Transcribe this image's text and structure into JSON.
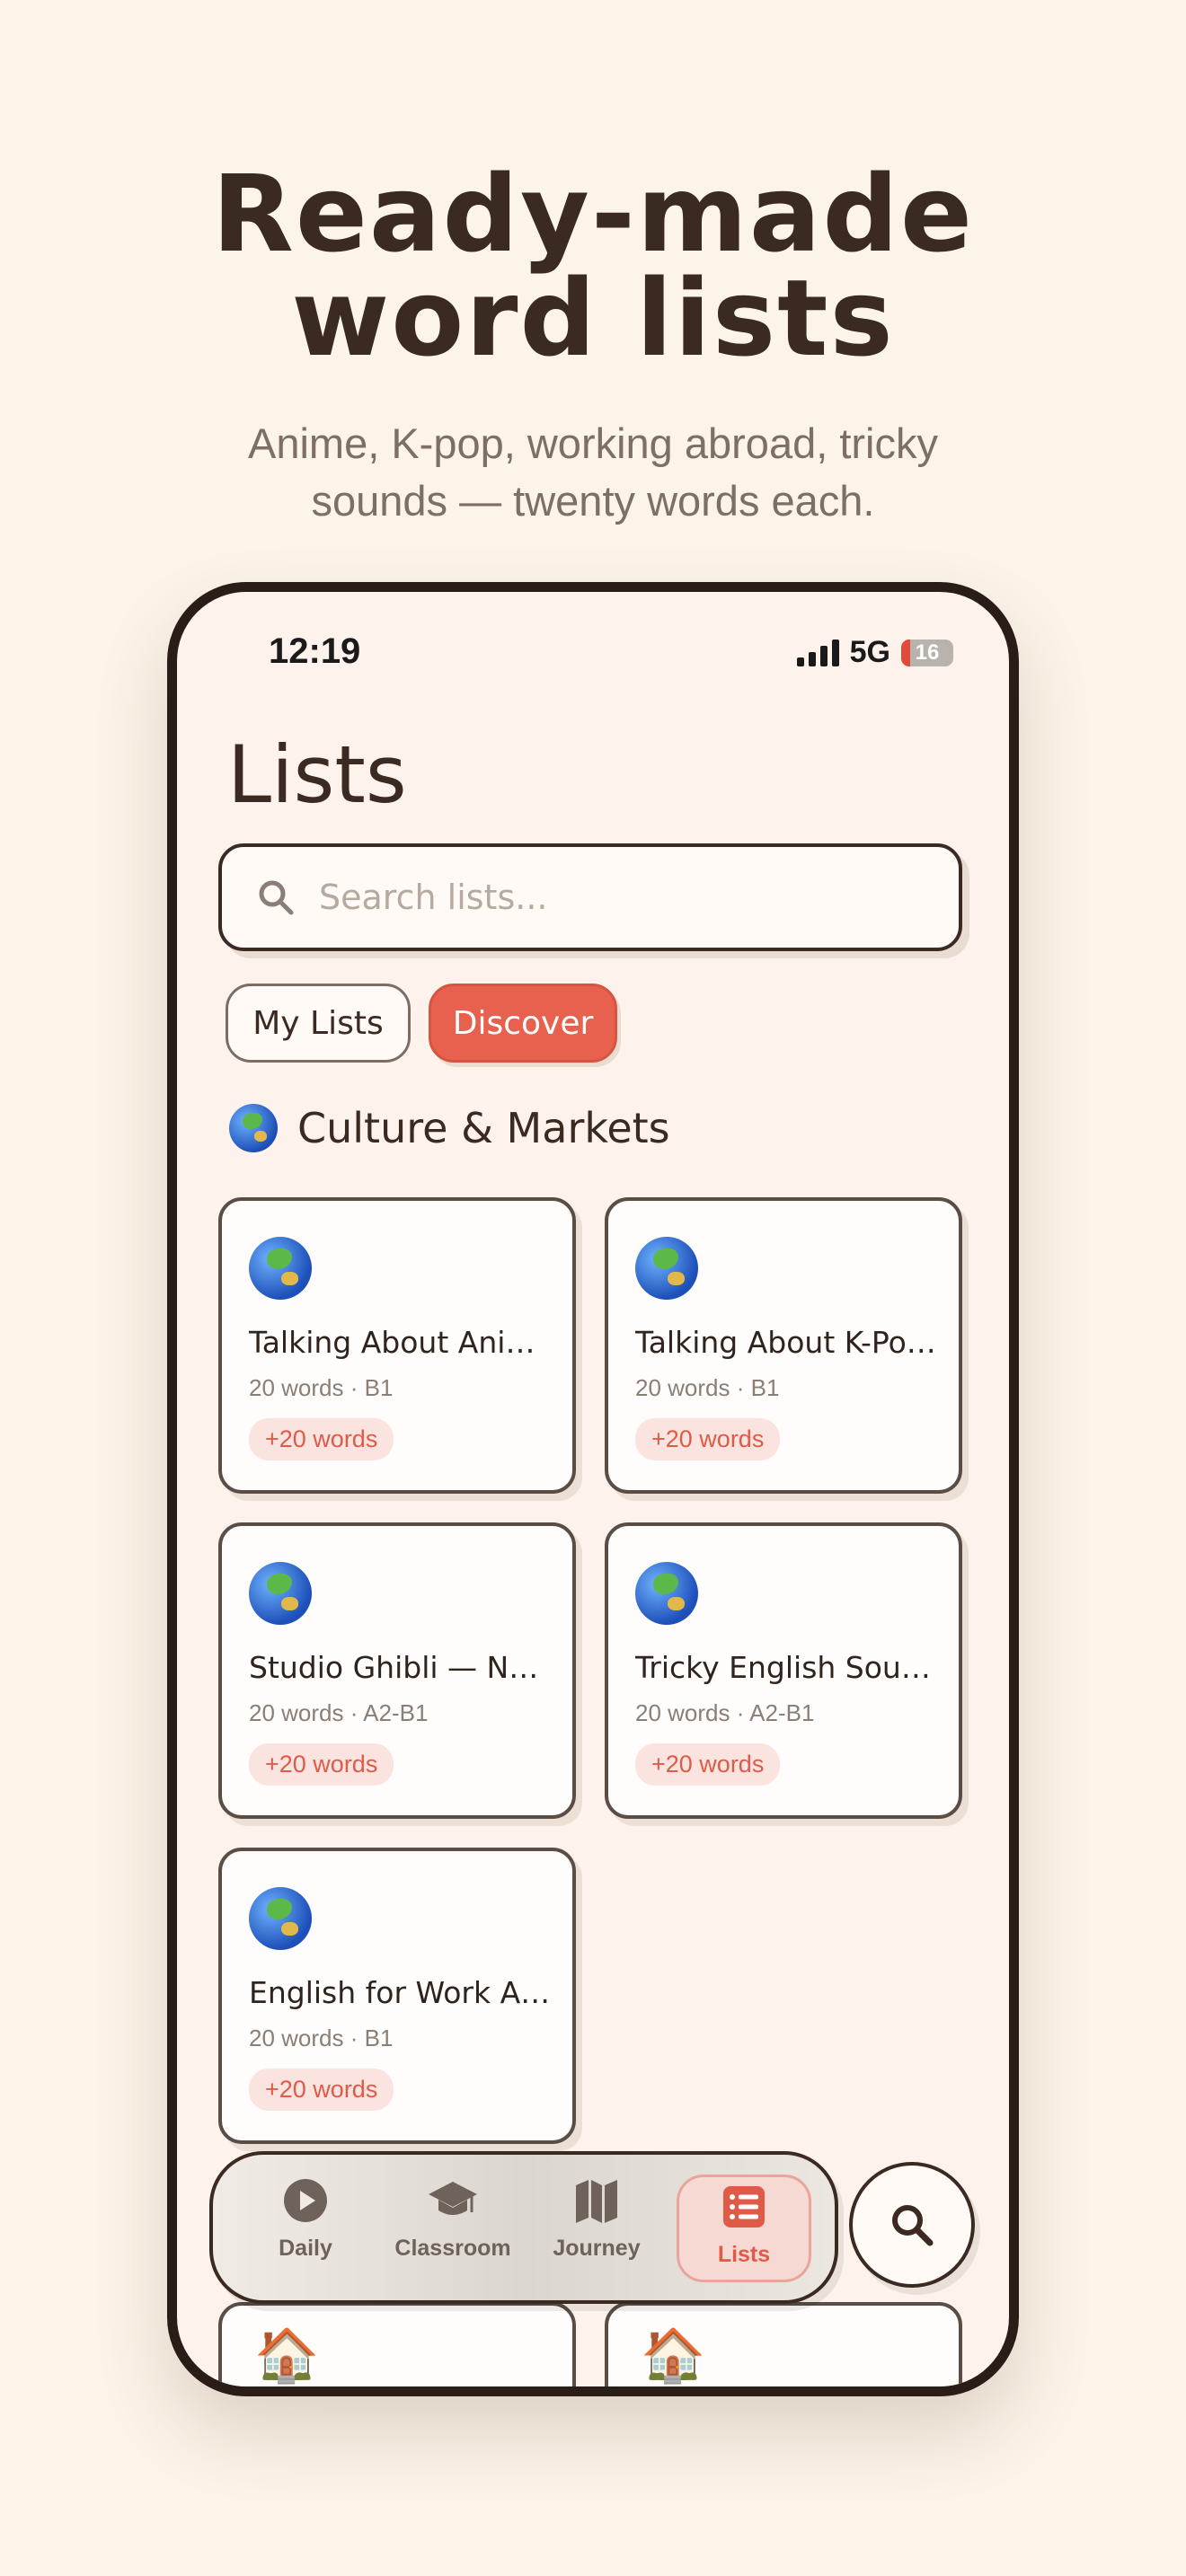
{
  "hero": {
    "title_line1": "Ready-made",
    "title_line2": "word lists",
    "subtitle_line1": "Anime, K-pop, working abroad, tricky",
    "subtitle_line2": "sounds — twenty words each."
  },
  "status_bar": {
    "time": "12:19",
    "network": "5G",
    "battery": "16"
  },
  "page": {
    "title": "Lists"
  },
  "search": {
    "placeholder": "Search lists..."
  },
  "segments": {
    "my_lists": "My Lists",
    "discover": "Discover",
    "active": "discover"
  },
  "section": {
    "icon": "globe-icon",
    "title": "Culture & Markets"
  },
  "cards": [
    {
      "icon": "globe-icon",
      "title": "Talking About Anime & Manga",
      "meta": "20 words · B1",
      "badge": "+20 words"
    },
    {
      "icon": "globe-icon",
      "title": "Talking About K-Pop & K-Drama",
      "meta": "20 words · B1",
      "badge": "+20 words"
    },
    {
      "icon": "globe-icon",
      "title": "Studio Ghibli — Nature & Magic",
      "meta": "20 words · A2-B1",
      "badge": "+20 words"
    },
    {
      "icon": "globe-icon",
      "title": "Tricky English Sounds for Speakers",
      "meta": "20 words · A2-B1",
      "badge": "+20 words"
    },
    {
      "icon": "globe-icon",
      "title": "English for Work Abroad",
      "meta": "20 words · B1",
      "badge": "+20 words"
    }
  ],
  "next_section_icon": "house-icon",
  "tabbar": {
    "tabs": [
      {
        "label": "Daily",
        "icon": "play-icon"
      },
      {
        "label": "Classroom",
        "icon": "graduation-cap-icon"
      },
      {
        "label": "Journey",
        "icon": "map-icon"
      },
      {
        "label": "Lists",
        "icon": "list-icon",
        "active": true
      }
    ]
  },
  "fab": {
    "icon": "search-icon"
  },
  "colors": {
    "background": "#fcf4e9",
    "accent": "#e8604e",
    "ink": "#3a2a22",
    "muted": "#8a7e76"
  }
}
